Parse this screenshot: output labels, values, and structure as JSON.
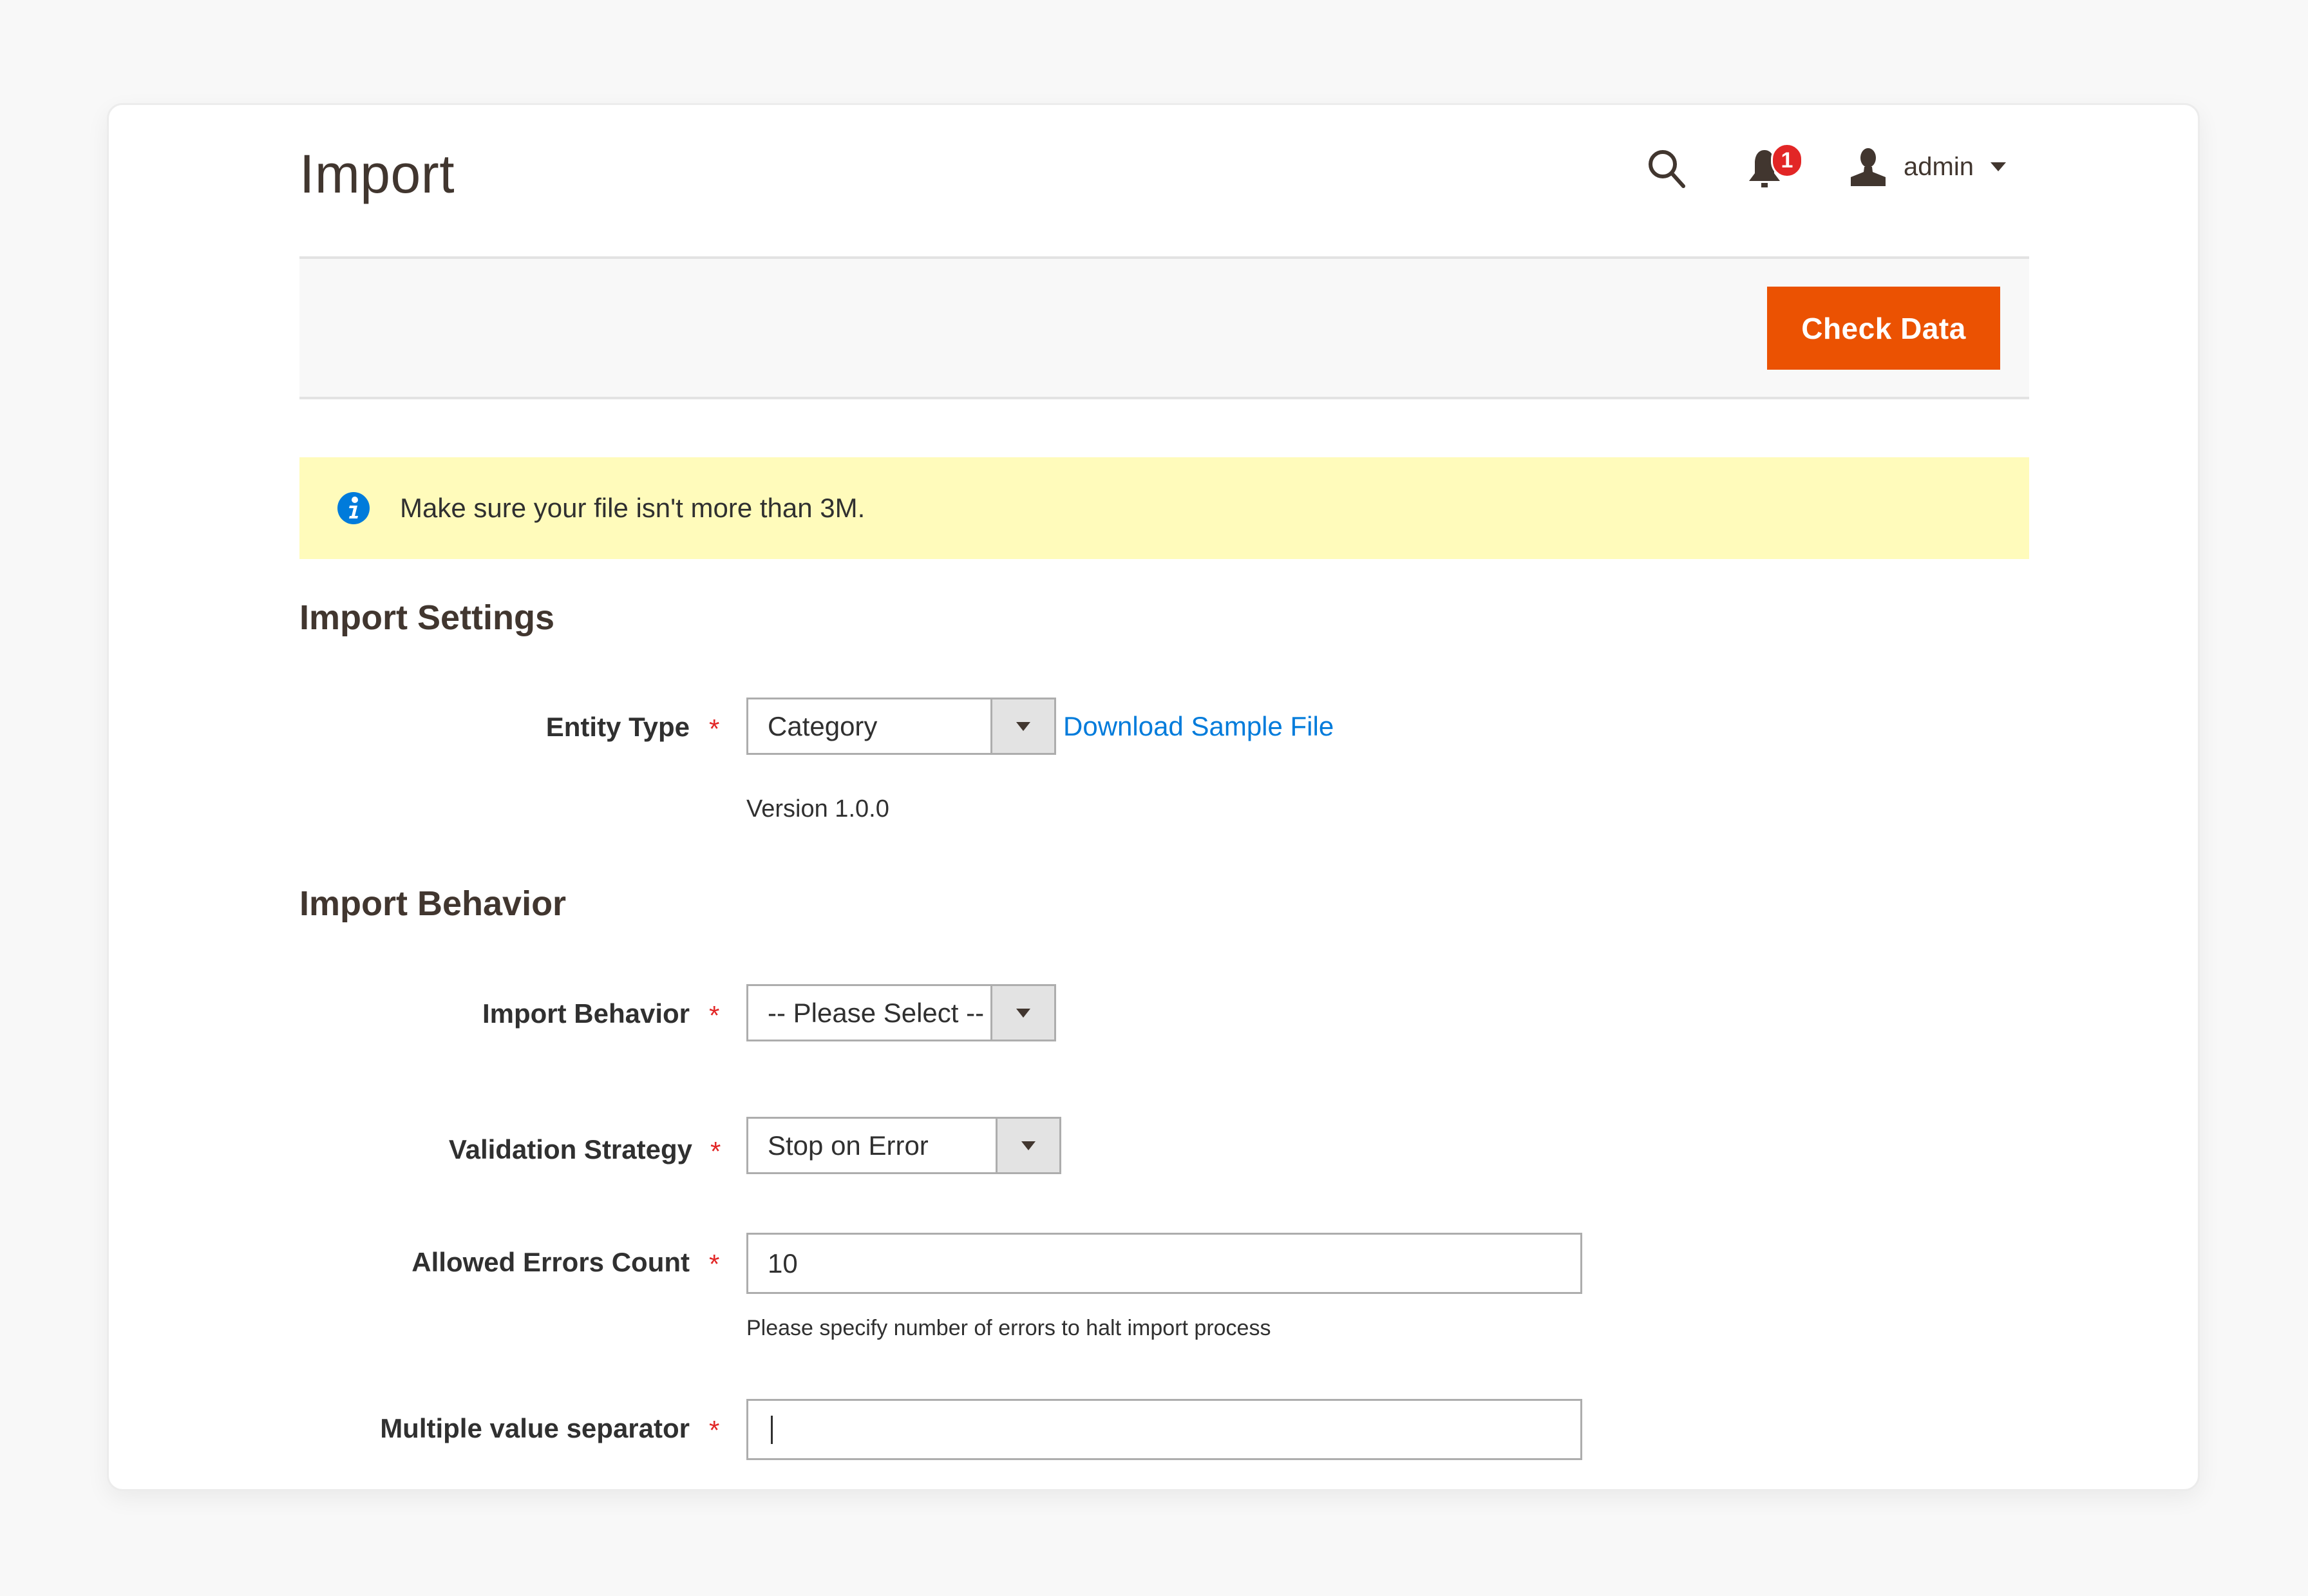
{
  "page": {
    "title": "Import"
  },
  "header": {
    "search_icon": "search-icon",
    "notifications": {
      "icon": "bell-icon",
      "count": "1"
    },
    "user": {
      "icon": "user-icon",
      "name": "admin",
      "menu_icon": "caret-down-icon"
    }
  },
  "toolbar": {
    "check_data_label": "Check Data"
  },
  "notice": {
    "icon": "info-icon",
    "text": "Make sure your file isn't more than 3M."
  },
  "sections": {
    "import_settings": {
      "title": "Import Settings",
      "entity_type": {
        "label": "Entity Type",
        "required_mark": "*",
        "value": "Category",
        "download_link": "Download Sample File",
        "version": "Version 1.0.0"
      }
    },
    "import_behavior": {
      "title": "Import Behavior",
      "behavior": {
        "label": "Import Behavior",
        "required_mark": "*",
        "value": "-- Please Select --"
      },
      "validation_strategy": {
        "label": "Validation Strategy",
        "required_mark": "*",
        "value": "Stop on Error"
      },
      "allowed_errors": {
        "label": "Allowed Errors Count",
        "required_mark": "*",
        "value": "10",
        "hint": "Please specify number of errors to halt import process"
      },
      "separator": {
        "label": "Multiple value separator",
        "required_mark": "*",
        "value": ""
      }
    }
  },
  "colors": {
    "accent": "#eb5202",
    "notice_bg": "#fffbbb",
    "link": "#007bdb",
    "required": "#e22626",
    "badge": "#e22626"
  }
}
